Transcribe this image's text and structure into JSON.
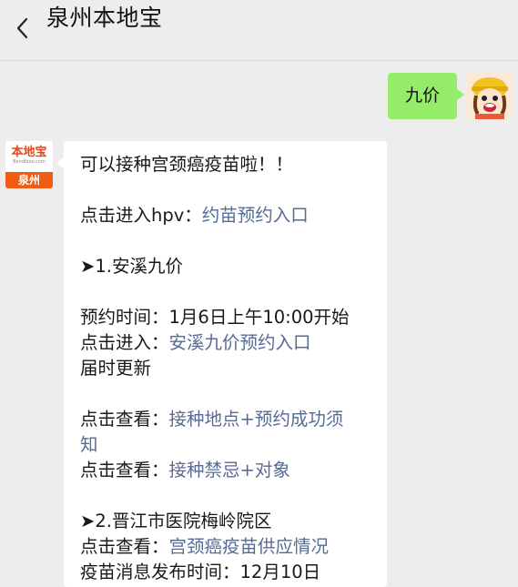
{
  "header": {
    "title": "泉州本地宝"
  },
  "outgoing": {
    "text": "九价"
  },
  "bot": {
    "logo_main": "本地宝",
    "logo_sub": "Bendibao.com",
    "logo_city": "泉州"
  },
  "message": {
    "l1": "可以接种宫颈癌疫苗啦！！",
    "l2_prefix": "点击进入hpv：",
    "l2_link": "约苗预约入口",
    "l3": "➤1.安溪九价",
    "l4": "预约时间：1月6日上午10:00开始",
    "l5_prefix": "点击进入：",
    "l5_link": "安溪九价预约入口",
    "l6": "届时更新",
    "l7_prefix": "点击查看：",
    "l7_link": "接种地点+预约成功须",
    "l8_link": "知",
    "l9_prefix": "点击查看：",
    "l9_link": "接种禁忌+对象",
    "l10": "➤2.晋江市医院梅岭院区",
    "l11_prefix": "点击查看：",
    "l11_link": "宫颈癌疫苗供应情况",
    "l12": "疫苗消息发布时间：12月10日"
  }
}
